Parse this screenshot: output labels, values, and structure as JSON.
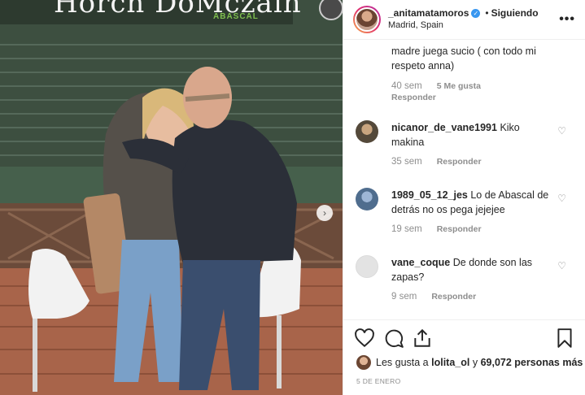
{
  "photo": {
    "sign_text": "Horch DoMczain",
    "sign_subtext": "ABASCAL",
    "next_icon": "chevron-right-icon"
  },
  "header": {
    "username": "_anitamatamoros",
    "verified_icon": "verified-badge-icon",
    "separator": "•",
    "follow_status": "Siguiendo",
    "location": "Madrid, Spain",
    "more_icon": "more-options-icon"
  },
  "comments": [
    {
      "username": "",
      "text": "madre juega sucio ( con todo mi respeto anna)",
      "time": "40 sem",
      "likes": "5 Me gusta",
      "reply": "Responder"
    },
    {
      "username": "nicanor_de_vane1991",
      "text": "Kiko makina",
      "time": "35 sem",
      "likes": "",
      "reply": "Responder"
    },
    {
      "username": "1989_05_12_jes",
      "text": "Lo de Abascal de detrás no os pega jejejee",
      "time": "19 sem",
      "likes": "",
      "reply": "Responder"
    },
    {
      "username": "vane_coque",
      "text": "De donde son las zapas?",
      "time": "9 sem",
      "likes": "",
      "reply": "Responder"
    }
  ],
  "actions": {
    "like_icon": "heart-icon",
    "comment_icon": "comment-icon",
    "share_icon": "share-icon",
    "save_icon": "bookmark-icon",
    "likes_prefix": "Les gusta a",
    "likes_user": "lolita_ol",
    "likes_connector": "y",
    "likes_count": "69,072 personas más",
    "date": "5 DE ENERO"
  }
}
